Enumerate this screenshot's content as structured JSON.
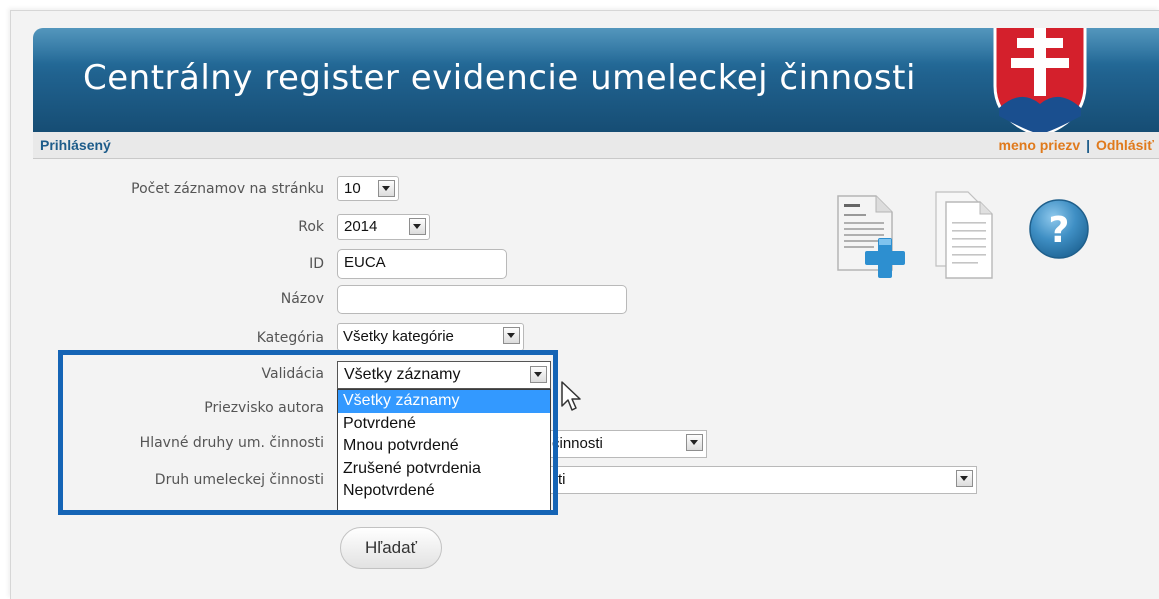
{
  "app": {
    "title": "Centrálny register evidencie umeleckej činnosti"
  },
  "status": {
    "left": "Prihlásený",
    "user": "meno priezv",
    "separator": "|",
    "logout": "Odhlásiť"
  },
  "form": {
    "per_page": {
      "label": "Počet záznamov na stránku",
      "value": "10"
    },
    "year": {
      "label": "Rok",
      "value": "2014"
    },
    "id": {
      "label": "ID",
      "value": "EUCA"
    },
    "name": {
      "label": "Názov",
      "value": ""
    },
    "category": {
      "label": "Kategória",
      "value": "Všetky kategórie"
    },
    "validation": {
      "label": "Validácia",
      "value": "Všetky záznamy"
    },
    "author": {
      "label": "Priezvisko autora"
    },
    "main_types": {
      "label": "Hlavné druhy um. činnosti",
      "value_visible": "činnosti"
    },
    "type": {
      "label": "Druh umeleckej činnosti",
      "value_visible": "ti"
    },
    "search_button": "Hľadať"
  },
  "validation_options": [
    {
      "label": "Všetky záznamy",
      "selected": true
    },
    {
      "label": "Potvrdené",
      "selected": false
    },
    {
      "label": "Mnou potvrdené",
      "selected": false
    },
    {
      "label": "Zrušené potvrdenia",
      "selected": false
    },
    {
      "label": "Nepotvrdené",
      "selected": false
    }
  ],
  "icons": [
    "new-document-icon",
    "documents-icon",
    "help-icon",
    "mouse-cursor-icon",
    "slovak-coat-of-arms-icon"
  ],
  "colors": {
    "banner": "#20628f",
    "status_label": "#1d5c8a",
    "user_link": "#e07a1c",
    "highlight": "#1564b5",
    "selected_option": "#3399ff"
  }
}
